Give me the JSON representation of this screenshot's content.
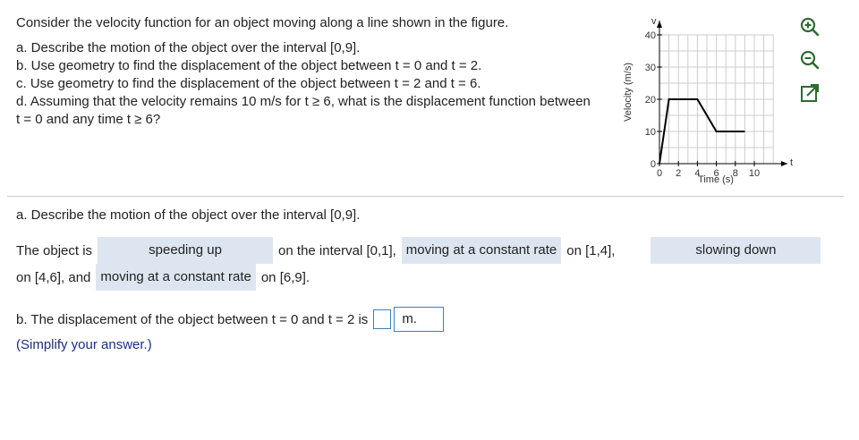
{
  "problem": {
    "intro": "Consider the velocity function for an object moving along a line shown in the figure.",
    "parts": [
      "a. Describe the motion of the object over the interval [0,9].",
      "b. Use geometry to find the displacement of the object between t = 0 and t = 2.",
      "c. Use geometry to find the displacement of the object between t = 2 and t = 6.",
      "d. Assuming that the velocity remains 10 m/s for t ≥ 6, what is the displacement function between t = 0 and any time t ≥ 6?"
    ]
  },
  "graph": {
    "y_axis_label": "Velocity (m/s)",
    "x_axis_label": "Time (s)",
    "y_var": "v",
    "x_var": "t",
    "y_ticks": [
      "0",
      "10",
      "20",
      "30",
      "40"
    ],
    "x_ticks": [
      "0",
      "2",
      "4",
      "6",
      "8",
      "10"
    ],
    "points": [
      [
        0,
        0
      ],
      [
        1,
        20
      ],
      [
        4,
        20
      ],
      [
        6,
        10
      ],
      [
        9,
        10
      ]
    ]
  },
  "tools": [
    "zoom-in-icon",
    "zoom-out-icon",
    "popout-icon"
  ],
  "answers": {
    "a_title": "a. Describe the motion of the object over the interval [0,9].",
    "a_text1": "The object is",
    "a_choice1": "speeding up",
    "a_text2": "on the interval [0,1],",
    "a_choice2": "moving at a constant rate",
    "a_text3": "on [1,4],",
    "a_choice3": "slowing down",
    "a_text4": "on [4,6], and",
    "a_choice4": "moving at a constant rate",
    "a_text5": "on [6,9].",
    "b_text": "b. The displacement of the object between t = 0 and t = 2 is",
    "b_unit": "m.",
    "b_hint": "(Simplify your answer.)"
  }
}
